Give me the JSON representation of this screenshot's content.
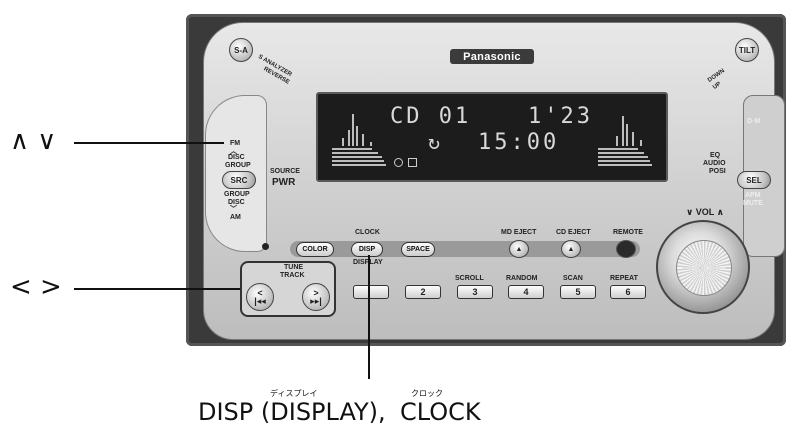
{
  "brand": "Panasonic",
  "buttons": {
    "sa": "S-A",
    "tilt": "TILT",
    "src": "SRC",
    "sel": "SEL",
    "color": "COLOR",
    "disp": "DISP",
    "space": "SPACE",
    "presets": [
      "",
      "2",
      "3",
      "4",
      "5",
      "6"
    ]
  },
  "labels": {
    "s_analyzer": "S ANALYZER",
    "reverse": "REVERSE",
    "down": "DOWN",
    "up": "UP",
    "source": "SOURCE",
    "pwr": "PWR",
    "fm": "FM",
    "disc_up": "DISC",
    "group_up": "GROUP",
    "group_down": "GROUP",
    "disc_down": "DISC",
    "am": "AM",
    "eq": "EQ",
    "audio": "AUDIO",
    "posi": "POSI",
    "dm": "D·M",
    "apm": "APM",
    "mute": "MUTE",
    "vol": "∨ VOL ∧",
    "clock": "CLOCK",
    "display": "DISPLAY",
    "md_eject": "MD EJECT",
    "cd_eject": "CD EJECT",
    "remote": "REMOTE",
    "tune": "TUNE",
    "track": "TRACK",
    "scroll": "SCROLL",
    "random": "RANDOM",
    "scan": "SCAN",
    "repeat": "REPEAT"
  },
  "display": {
    "line1_left": "CD 01",
    "line1_right": "1'23",
    "line2": "15:00"
  },
  "annotations": {
    "updown": "∧ ∨",
    "leftright": "< >",
    "disp_ruby": "ディスプレイ",
    "clock_ruby": "クロック",
    "disp_caption": "DISP (DISPLAY),",
    "clock_caption": "CLOCK"
  }
}
